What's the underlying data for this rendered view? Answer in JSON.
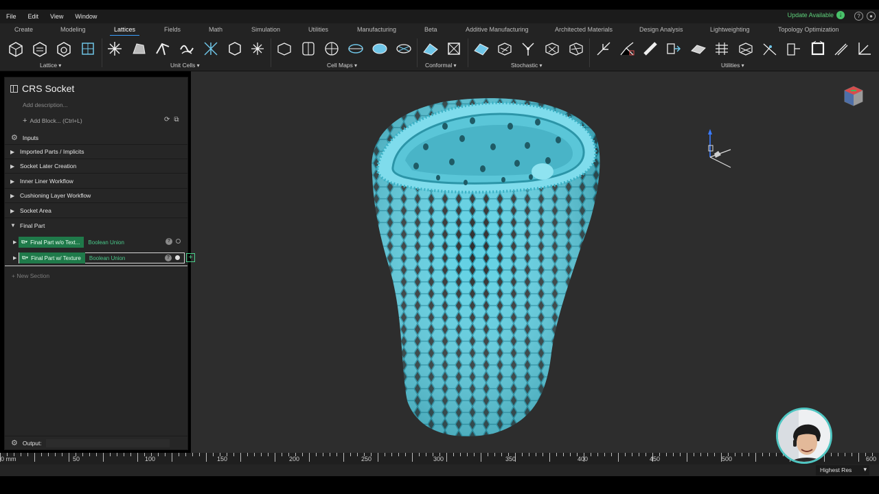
{
  "menu": {
    "items": [
      "File",
      "Edit",
      "View",
      "Window"
    ],
    "update_label": "Update Available"
  },
  "tabs": [
    "Create",
    "Modeling",
    "Lattices",
    "Fields",
    "Math",
    "Simulation",
    "Utilities",
    "Manufacturing",
    "Beta",
    "Additive Manufacturing",
    "Architected Materials",
    "Design Analysis",
    "Lightweighting",
    "Topology Optimization"
  ],
  "active_tab": "Lattices",
  "ribbon_groups": [
    "Lattice",
    "Unit Cells",
    "Cell Maps",
    "Conformal",
    "Stochastic",
    "Utilities"
  ],
  "panel": {
    "title": "CRS Socket",
    "description_placeholder": "Add description...",
    "add_block": "Add Block... (Ctrl+L)",
    "inputs": "Inputs",
    "sections": [
      "Imported Parts / Implicits",
      "Socket Later Creation",
      "Inner Liner Workflow",
      "Cushioning Layer Workflow",
      "Socket Area",
      "Final Part"
    ],
    "blocks": [
      {
        "name": "Final Part w/o Text...",
        "op": "Boolean Union"
      },
      {
        "name": "Final Part w/ Texture",
        "op": "Boolean Union"
      }
    ],
    "new_section": "New Section",
    "output": "Output:"
  },
  "ruler": {
    "labels": [
      "0 mm",
      "50",
      "100",
      "150",
      "200",
      "250",
      "300",
      "350",
      "400",
      "450",
      "500",
      "600"
    ]
  },
  "status": {
    "resolution": "Highest Res"
  },
  "colors": {
    "model": "#56c8dc",
    "accent_green": "#1f7a4a",
    "update_green": "#5ed17b"
  }
}
